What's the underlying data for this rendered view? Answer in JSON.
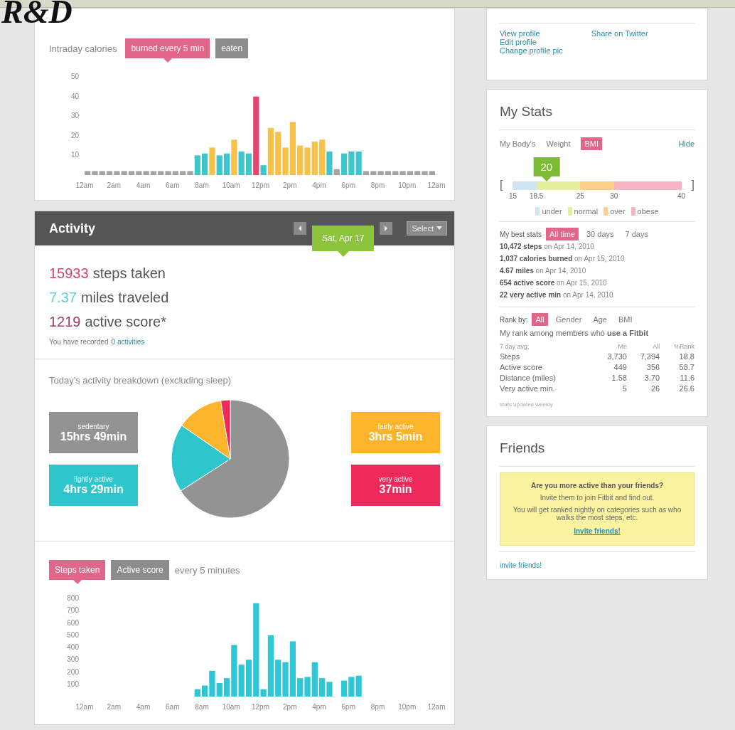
{
  "overlay_title": "R&D",
  "calories": {
    "title": "Intraday calories",
    "tabs": [
      {
        "label": "burned every 5 min",
        "selected": true
      },
      {
        "label": "eaten",
        "selected": false
      }
    ],
    "y_axis_labels": [
      "50",
      "40",
      "30",
      "20",
      "10"
    ],
    "x_axis_labels": [
      "12am",
      "2am",
      "4am",
      "6am",
      "8am",
      "10am",
      "12pm",
      "2pm",
      "4pm",
      "6pm",
      "8pm",
      "10pm",
      "12am"
    ]
  },
  "activity": {
    "title": "Activity",
    "date": "Sat, Apr 17",
    "select": "Select",
    "stats": [
      {
        "value": "15933",
        "label": "steps taken",
        "color": "#d6457a"
      },
      {
        "value": "7.37",
        "label": "miles traveled",
        "color": "#5fcfd6"
      },
      {
        "value": "1219",
        "label": "active score*",
        "color": "#a83a6a"
      }
    ],
    "recorded": "You have recorded",
    "recorded_link": "0 activities"
  },
  "breakdown": {
    "title": "Today's activity breakdown (excluding sleep)",
    "items": [
      {
        "label": "sedentary",
        "duration": "15hrs 49min",
        "color": "#939393"
      },
      {
        "label": "lightly active",
        "duration": "4hrs 29min",
        "color": "#2ec5cc"
      },
      {
        "label": "fairly active",
        "duration": "3hrs 5min",
        "color": "#fbb42c"
      },
      {
        "label": "very active",
        "duration": "37min",
        "color": "#ee2a5d"
      }
    ],
    "chart_data": {
      "type": "pie",
      "values": [
        65.9,
        18.7,
        12.8,
        2.6
      ]
    }
  },
  "steps": {
    "tabs": [
      {
        "label": "Steps taken",
        "selected": true
      },
      {
        "label": "Active score",
        "selected": false
      }
    ],
    "note": "every 5 minutes",
    "y_axis_labels": [
      "800",
      "700",
      "600",
      "500",
      "400",
      "300",
      "200",
      "100"
    ],
    "x_axis_labels": [
      "12am",
      "2am",
      "4am",
      "6am",
      "8am",
      "10am",
      "12pm",
      "2pm",
      "4pm",
      "6pm",
      "8pm",
      "10pm",
      "12am"
    ]
  },
  "profile": {
    "links_left": [
      "View profile",
      "Edit profile",
      "Change profile pic"
    ],
    "links_right": [
      "Share on Twitter"
    ]
  },
  "my_stats": {
    "title": "My Stats",
    "body_label": "My Body's",
    "tabs": [
      {
        "label": "Weight",
        "selected": false
      },
      {
        "label": "BMI",
        "selected": true
      }
    ],
    "hide": "Hide",
    "bmi": {
      "value": "20",
      "level": 0.2,
      "bracket_left": "[",
      "bracket_right": "]",
      "scale": [
        "15",
        "18.5",
        "25",
        "30",
        "40"
      ],
      "legend": [
        {
          "label": "under",
          "color": "#cfe6f0"
        },
        {
          "label": "normal",
          "color": "#e3ef9c"
        },
        {
          "label": "over",
          "color": "#fcd08a"
        },
        {
          "label": "obese",
          "color": "#f5b5c2"
        }
      ]
    },
    "best_label": "My best stats",
    "best_tabs": [
      {
        "label": "All time",
        "selected": true
      },
      {
        "label": "30 days",
        "selected": false
      },
      {
        "label": "7 days",
        "selected": false
      }
    ],
    "best_lines": [
      "**10,472 steps** on Apr 14, 2010",
      "**1,037 calories burned** on Apr 15, 2010",
      "**4.67 miles** on Apr 14, 2010",
      "**654 active score** on Apr 15, 2010",
      "**22 very active min** on Apr 14, 2010"
    ],
    "rank_label": "Rank by:",
    "rank_tabs": [
      {
        "label": "All",
        "selected": true
      },
      {
        "label": "Gender",
        "selected": false
      },
      {
        "label": "Age",
        "selected": false
      },
      {
        "label": "BMI",
        "selected": false
      }
    ],
    "rank_caption": "My rank among members who **use a Fitbit**",
    "rank_columns": [
      "7 day avg.",
      "Me",
      "All",
      "%Rank"
    ],
    "rank_rows": [
      [
        "Steps",
        "3,730",
        "7,394",
        "18.8"
      ],
      [
        "Active score",
        "449",
        "356",
        "58.7"
      ],
      [
        "Distance (miles)",
        "1.58",
        "3.70",
        "11.6"
      ],
      [
        "Very active min.",
        "5",
        "26",
        "26.6"
      ]
    ],
    "rank_footnote": "stats updated weekly"
  },
  "friends": {
    "title": "Friends",
    "prompt_heading": "Are you more active than your friends?",
    "prompt_lines": [
      "Invite them to join Fitbit and find out.",
      "You will get ranked nightly on categories such as who walks the most steps, etc."
    ],
    "prompt_link": "Invite friends!",
    "invite": "invite friends!"
  }
}
